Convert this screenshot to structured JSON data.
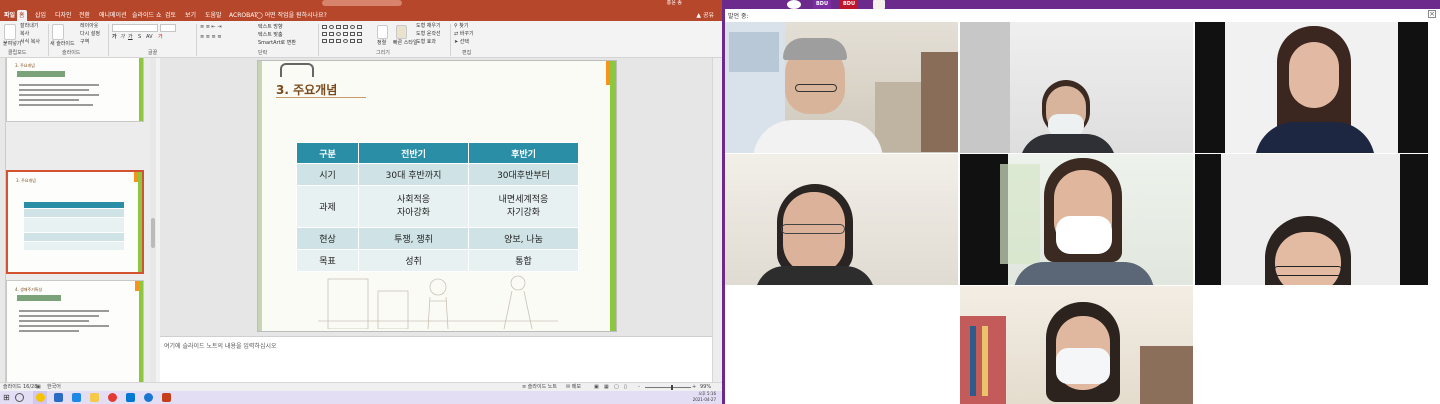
{
  "ppt": {
    "titlebar": {
      "search_text": "여기에 검색어를 입력하십시오",
      "user": "홍윤 송"
    },
    "tabs": [
      "파일",
      "홈",
      "삽입",
      "디자인",
      "전환",
      "애니메이션",
      "슬라이드 쇼",
      "검토",
      "보기",
      "도움말",
      "ACROBAT"
    ],
    "active_tab": "홈",
    "tell_me": "어떤 작업을 원하시나요?",
    "share_label": "공유",
    "ribbon": {
      "groups": [
        "클립보드",
        "슬라이드",
        "글꼴",
        "단락",
        "그리기",
        "편집"
      ],
      "paste": "붙여넣기",
      "cut": "잘라내기",
      "copy": "복사",
      "format_painter": "서식 복사",
      "new_slide": "새 슬라이드",
      "layout": "레이아웃",
      "reset": "다시 설정",
      "section": "구역",
      "text_direction": "텍스트 방향",
      "align_text": "텍스트 맞춤",
      "smartart": "SmartArt로 변환",
      "arrange": "정렬",
      "quick_styles": "빠른 스타일",
      "shape_fill": "도형 채우기",
      "shape_outline": "도형 윤곽선",
      "shape_effects": "도형 효과",
      "find": "찾기",
      "replace": "바꾸기",
      "select": "선택"
    },
    "thumb_titles": [
      "3. 주요개념",
      "3. 주요개념",
      "4. 생애주기특성"
    ],
    "slide": {
      "title": "3. 주요개념",
      "table": {
        "headers": [
          "구분",
          "전반기",
          "후반기"
        ],
        "rows": [
          [
            "시기",
            "30대 후반까지",
            "30대후반부터"
          ],
          [
            "과제",
            "사회적응\n자아강화",
            "내면세계적응\n자기강화"
          ],
          [
            "현상",
            "투쟁, 쟁취",
            "양보, 나눔"
          ],
          [
            "목표",
            "성취",
            "통합"
          ]
        ]
      }
    },
    "notes_placeholder": "여기에 슬라이드 노트의 내용을 입력하십시오",
    "status": {
      "slide_counter": "슬라이드 16/28",
      "language": "한국어",
      "notes_btn": "슬라이드 노트",
      "comments_btn": "메모",
      "zoom": "99%"
    },
    "clock": {
      "time": "오후 5:16",
      "date": "2021-04-27"
    }
  },
  "conference": {
    "speaker_label": "발언 중:",
    "logos": [
      "BDU",
      "BDU"
    ]
  }
}
